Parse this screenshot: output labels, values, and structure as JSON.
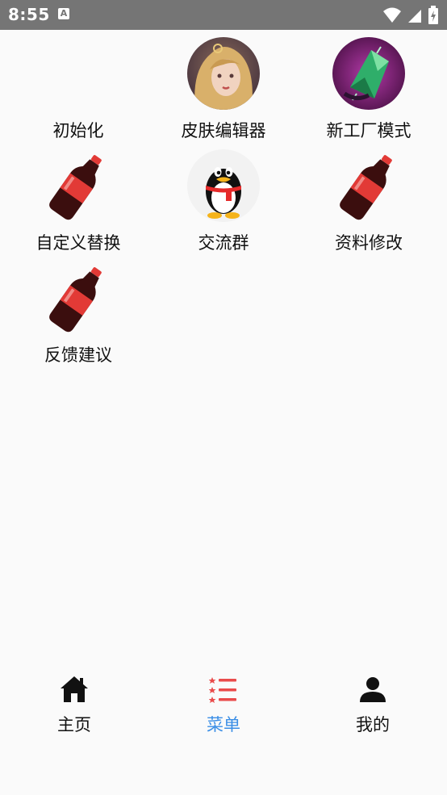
{
  "status_bar": {
    "time": "8:55",
    "notification_icon": "A",
    "icons": [
      "wifi-icon",
      "signal-icon",
      "battery-icon"
    ]
  },
  "menu": {
    "items": [
      {
        "label": "初始化",
        "icon": "none"
      },
      {
        "label": "皮肤编辑器",
        "icon": "hero-avatar-icon"
      },
      {
        "label": "新工厂模式",
        "icon": "green-gem-icon"
      },
      {
        "label": "自定义替换",
        "icon": "cola-bottle-icon"
      },
      {
        "label": "交流群",
        "icon": "qq-penguin-icon"
      },
      {
        "label": "资料修改",
        "icon": "cola-bottle-icon"
      },
      {
        "label": "反馈建议",
        "icon": "cola-bottle-icon"
      }
    ]
  },
  "tab_bar": {
    "tabs": [
      {
        "label": "主页",
        "icon": "home-icon",
        "active": false
      },
      {
        "label": "菜单",
        "icon": "menu-list-icon",
        "active": true
      },
      {
        "label": "我的",
        "icon": "person-icon",
        "active": false
      }
    ],
    "active_color": "#3a8ee6",
    "menu_icon_color": "#e94b4b"
  }
}
